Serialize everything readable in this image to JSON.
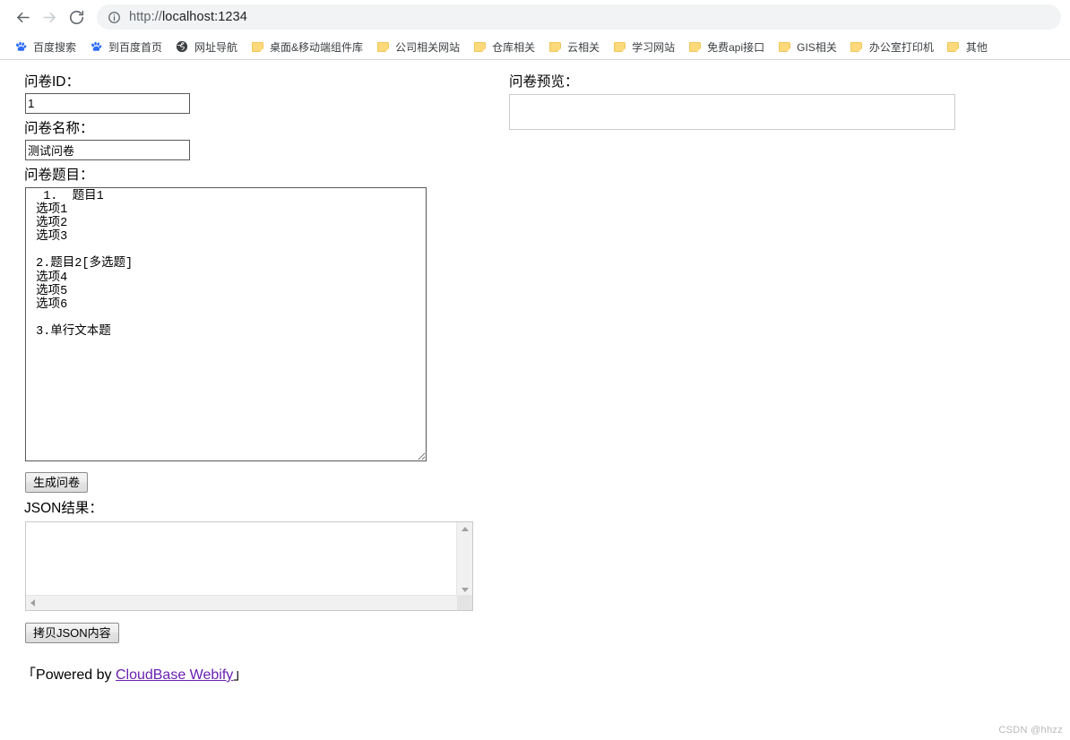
{
  "browser": {
    "back_icon": "back-arrow-icon",
    "forward_icon": "forward-arrow-icon",
    "reload_icon": "reload-icon",
    "info_icon": "page-info-icon",
    "url_scheme": "http://",
    "url_host": "localhost:1234",
    "url_full": "http://localhost:1234",
    "bookmarks": [
      {
        "label": "百度搜索",
        "icon": "baidu-paw-icon",
        "icon_type": "paw"
      },
      {
        "label": "到百度首页",
        "icon": "baidu-paw-icon",
        "icon_type": "paw"
      },
      {
        "label": "网址导航",
        "icon": "globe-icon",
        "icon_type": "globe"
      },
      {
        "label": "桌面&移动端组件库",
        "icon": "folder-icon",
        "icon_type": "folder"
      },
      {
        "label": "公司相关网站",
        "icon": "folder-icon",
        "icon_type": "folder"
      },
      {
        "label": "仓库相关",
        "icon": "folder-icon",
        "icon_type": "folder"
      },
      {
        "label": "云相关",
        "icon": "folder-icon",
        "icon_type": "folder"
      },
      {
        "label": "学习网站",
        "icon": "folder-icon",
        "icon_type": "folder"
      },
      {
        "label": "免费api接口",
        "icon": "folder-icon",
        "icon_type": "folder"
      },
      {
        "label": "GIS相关",
        "icon": "folder-icon",
        "icon_type": "folder"
      },
      {
        "label": "办公室打印机",
        "icon": "folder-icon",
        "icon_type": "folder"
      },
      {
        "label": "其他",
        "icon": "folder-icon",
        "icon_type": "folder"
      }
    ]
  },
  "form": {
    "id_label": "问卷ID：",
    "id_value": "1",
    "name_label": "问卷名称：",
    "name_value": "测试问卷",
    "questions_label": "问卷题目：",
    "questions_value": "  1.  题目1\n 选项1\n 选项2\n 选项3\n\n 2.题目2[多选题]\n 选项4\n 选项5\n 选项6\n\n 3.单行文本题",
    "generate_button": "生成问卷",
    "json_label": "JSON结果：",
    "json_value": "",
    "copy_button": "拷贝JSON内容"
  },
  "preview": {
    "label": "问卷预览：",
    "content": ""
  },
  "footer": {
    "bracket_open": "「",
    "prefix": "Powered by ",
    "link_text": "CloudBase Webify",
    "bracket_close": "」"
  },
  "watermark": "CSDN @hhzz",
  "colors": {
    "link": "#6a1fb0",
    "omnibox_bg": "#f1f3f4",
    "folder": "#fcd97a",
    "baidu_blue": "#2e6cf6",
    "input_border": "#595959",
    "preview_border": "#cccccc"
  }
}
